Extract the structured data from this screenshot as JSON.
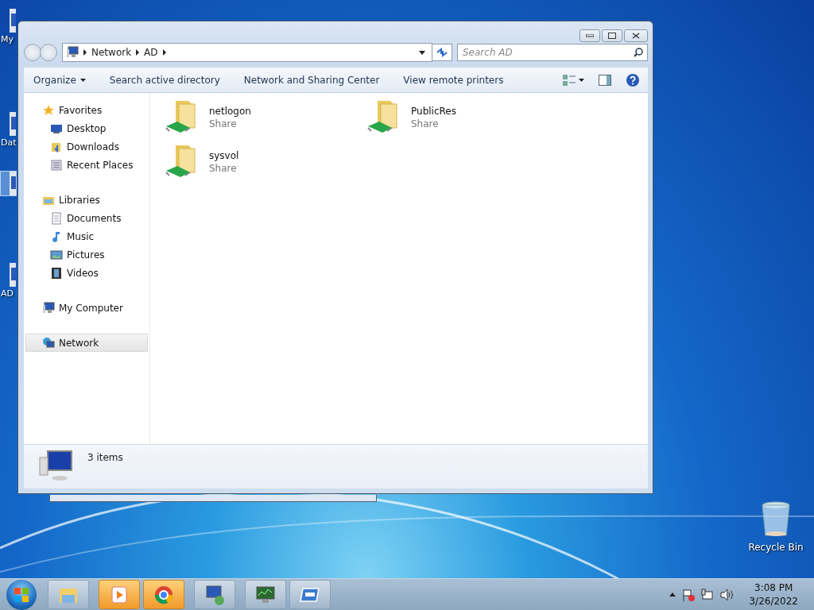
{
  "desktop_icons": [
    {
      "label": "My",
      "selected": false
    },
    {
      "label": "Dat",
      "selected": false
    },
    {
      "selected": true
    },
    {
      "label": "AD",
      "selected": false
    }
  ],
  "recycle_bin": {
    "label": "Recycle Bin"
  },
  "window": {
    "address": {
      "segments": [
        "Network",
        "AD"
      ]
    },
    "search": {
      "placeholder": "Search AD"
    },
    "toolbar": [
      {
        "label": "Organize",
        "dropdown": true
      },
      {
        "label": "Search active directory",
        "dropdown": false
      },
      {
        "label": "Network and Sharing Center",
        "dropdown": false
      },
      {
        "label": "View remote printers",
        "dropdown": false
      }
    ],
    "nav": [
      {
        "label": "Favorites",
        "kind": "star",
        "selected": false,
        "children": [
          {
            "label": "Desktop",
            "kind": "desktop",
            "selected": false
          },
          {
            "label": "Downloads",
            "kind": "downloads",
            "selected": false
          },
          {
            "label": "Recent Places",
            "kind": "recent",
            "selected": false
          }
        ]
      },
      {
        "label": "Libraries",
        "kind": "library",
        "selected": false,
        "children": [
          {
            "label": "Documents",
            "kind": "document",
            "selected": false
          },
          {
            "label": "Music",
            "kind": "music",
            "selected": false
          },
          {
            "label": "Pictures",
            "kind": "pictures",
            "selected": false
          },
          {
            "label": "Videos",
            "kind": "videos",
            "selected": false
          }
        ]
      },
      {
        "label": "My Computer",
        "kind": "computer",
        "selected": false
      },
      {
        "label": "Network",
        "kind": "network",
        "selected": true
      }
    ],
    "items": [
      {
        "name": "netlogon",
        "type": "Share"
      },
      {
        "name": "PublicRes",
        "type": "Share"
      },
      {
        "name": "sysvol",
        "type": "Share"
      }
    ],
    "status": "3 items"
  },
  "taskbar": {
    "apps": [
      {
        "kind": "explorer",
        "highlighted": false
      },
      {
        "kind": "media",
        "highlighted": true
      },
      {
        "kind": "chrome",
        "highlighted": true
      },
      {
        "kind": "remote",
        "highlighted": false
      },
      {
        "kind": "monitor",
        "highlighted": false
      },
      {
        "kind": "window",
        "highlighted": false
      }
    ],
    "time": "3:08 PM",
    "date": "3/26/2022"
  }
}
